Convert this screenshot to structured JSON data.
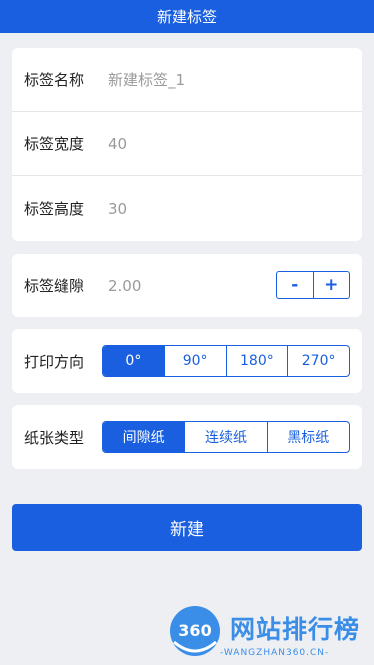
{
  "header": {
    "title": "新建标签"
  },
  "fields": [
    {
      "label": "标签名称",
      "placeholder": "新建标签_1"
    },
    {
      "label": "标签宽度",
      "value": "40"
    },
    {
      "label": "标签高度",
      "value": "30"
    }
  ],
  "gap": {
    "label": "标签缝隙",
    "value": "2.00",
    "minus": "-",
    "plus": "+"
  },
  "orientation": {
    "label": "打印方向",
    "options": [
      "0°",
      "90°",
      "180°",
      "270°"
    ],
    "selected": "0°"
  },
  "paper": {
    "label": "纸张类型",
    "options": [
      "间隙纸",
      "连续纸",
      "黑标纸"
    ],
    "selected": "间隙纸"
  },
  "submit": {
    "label": "新建"
  },
  "watermark": {
    "logo_text": "360",
    "title": "网站排行榜",
    "subtitle": "-WANGZHAN360.CN-"
  },
  "colors": {
    "primary": "#1a5fe0",
    "background": "#eeeff3",
    "watermark": "#3a8ee8"
  }
}
